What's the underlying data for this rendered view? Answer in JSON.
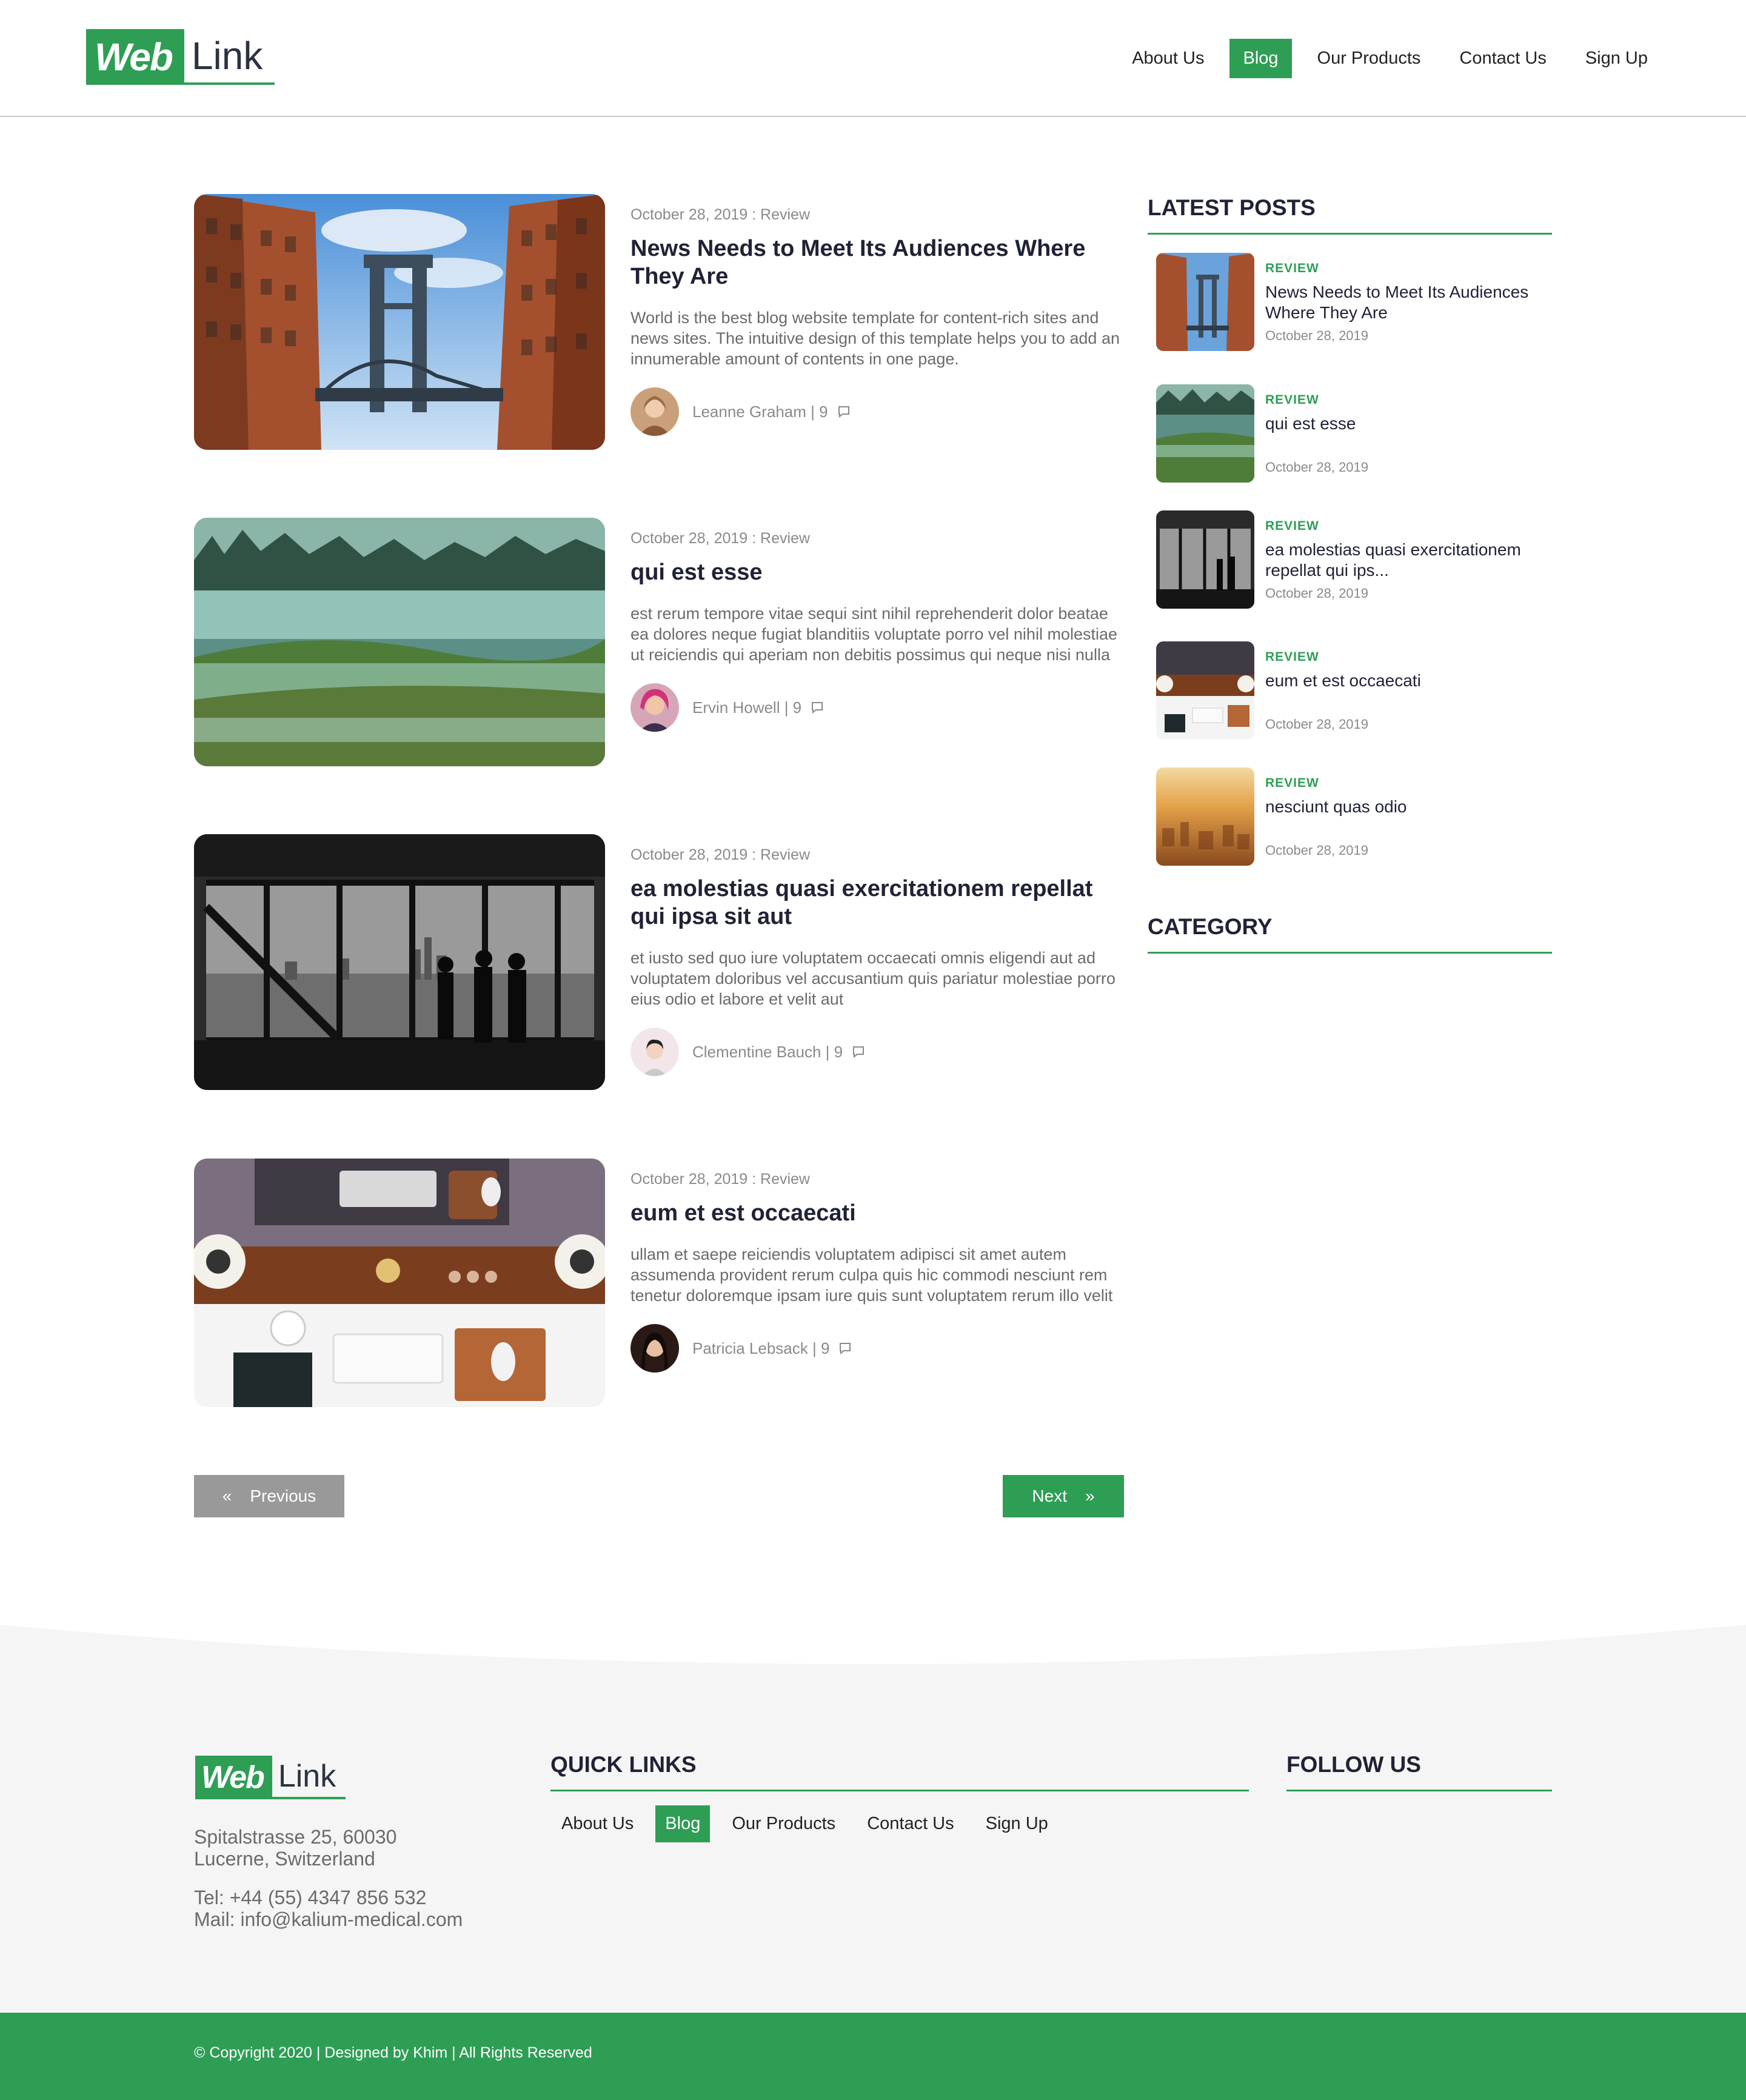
{
  "brand": {
    "logo_mark": "Web",
    "logo_text": "Link",
    "accent_color": "#2e9e55"
  },
  "nav": {
    "items": [
      {
        "label": "About Us",
        "active": false
      },
      {
        "label": "Blog",
        "active": true
      },
      {
        "label": "Our Products",
        "active": false
      },
      {
        "label": "Contact Us",
        "active": false
      },
      {
        "label": "Sign Up",
        "active": false
      }
    ]
  },
  "posts": [
    {
      "meta": "October 28, 2019 : Review",
      "title": "News Needs to Meet Its Audiences Where They Are",
      "excerpt": "World is the best blog website template for content-rich sites and news sites. The intuitive design of this template helps you to add an innumerable amount of contents in one page.",
      "author": "Leanne Graham | 9",
      "image": "bridge-photo",
      "icon": "comment-icon"
    },
    {
      "meta": "October 28, 2019 : Review",
      "title": "qui est esse",
      "excerpt": "est rerum tempore vitae sequi sint nihil reprehenderit dolor beatae ea dolores neque fugiat blanditiis voluptate porro vel nihil molestiae ut reiciendis qui aperiam non debitis possimus qui neque nisi nulla",
      "author": "Ervin Howell | 9",
      "image": "foggy-landscape-photo",
      "icon": "comment-icon"
    },
    {
      "meta": "October 28, 2019 : Review",
      "title": "ea molestias quasi exercitationem repellat qui ipsa sit aut",
      "excerpt": "et iusto sed quo iure voluptatem occaecati omnis eligendi aut ad voluptatem doloribus vel accusantium quis pariatur molestiae porro eius odio et labore et velit aut",
      "author": "Clementine Bauch | 9",
      "image": "office-window-photo",
      "icon": "comment-icon"
    },
    {
      "meta": "October 28, 2019 : Review",
      "title": "eum et est occaecati",
      "excerpt": "ullam et saepe reiciendis voluptatem adipisci sit amet autem assumenda provident rerum culpa quis hic commodi nesciunt rem tenetur doloremque ipsam iure quis sunt voluptatem rerum illo velit",
      "author": "Patricia Lebsack | 9",
      "image": "desk-workspace-photo",
      "icon": "comment-icon"
    }
  ],
  "pagination": {
    "previous": "Previous",
    "next": "Next",
    "prev_icon": "«",
    "next_icon": "»"
  },
  "sidebar": {
    "latest_heading": "LATEST POSTS",
    "category_heading": "CATEGORY",
    "latest": [
      {
        "category": "REVIEW",
        "title": "News Needs to Meet Its Audiences Where They Are",
        "date": "October 28, 2019"
      },
      {
        "category": "REVIEW",
        "title": "qui est esse",
        "date": "October 28, 2019"
      },
      {
        "category": "REVIEW",
        "title": "ea molestias quasi exercitationem repellat qui ips...",
        "date": "October 28, 2019"
      },
      {
        "category": "REVIEW",
        "title": "eum et est occaecati",
        "date": "October 28, 2019"
      },
      {
        "category": "REVIEW",
        "title": "nesciunt quas odio",
        "date": "October 28, 2019"
      }
    ]
  },
  "footer": {
    "address_line1": "Spitalstrasse 25, 60030",
    "address_line2": "Lucerne, Switzerland",
    "tel": "Tel: +44 (55) 4347 856 532",
    "mail": "Mail: info@kalium-medical.com",
    "quick_links_heading": "QUICK LINKS",
    "follow_heading": "FOLLOW US",
    "copyright": "© Copyright 2020 | Designed by Khim | All Rights Reserved"
  }
}
